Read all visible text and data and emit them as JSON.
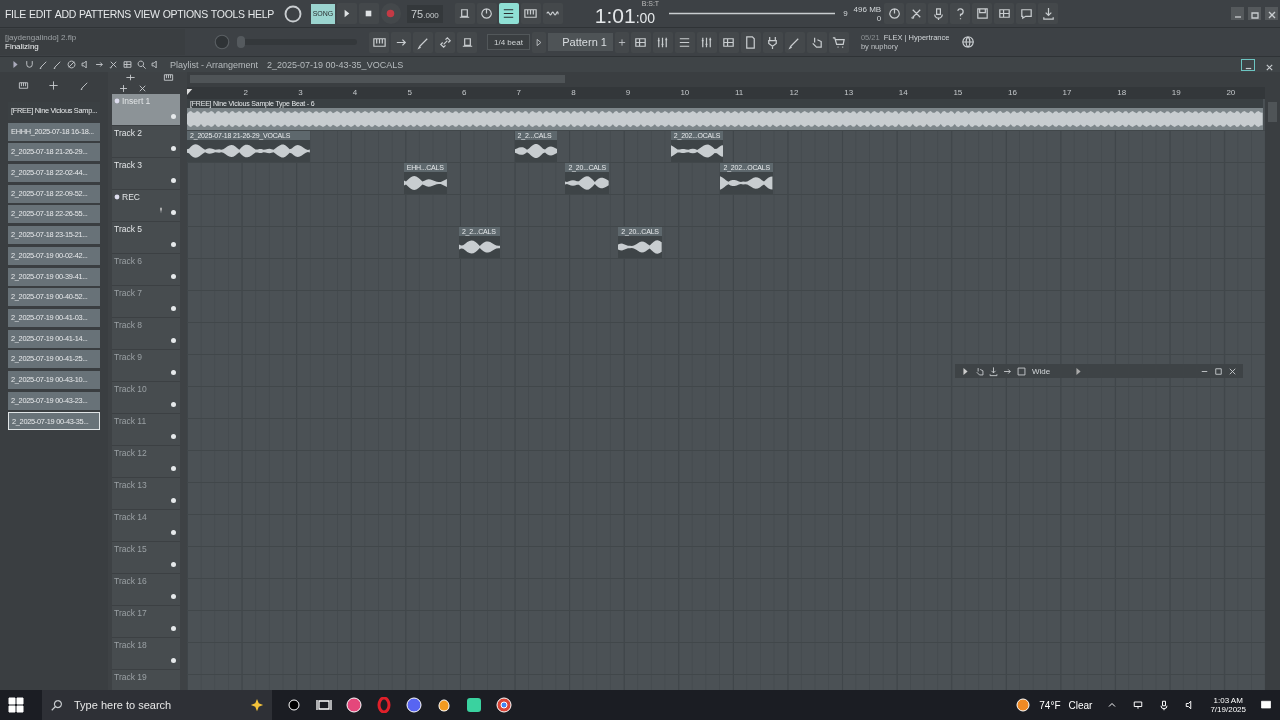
{
  "menu": [
    "FILE",
    "EDIT",
    "ADD",
    "PATTERNS",
    "VIEW",
    "OPTIONS",
    "TOOLS",
    "HELP"
  ],
  "transport": {
    "song_label": "SONG",
    "song_selected": true,
    "tempo": "75",
    "tempo_fraction": ".000",
    "recording": false
  },
  "toggles": [
    {
      "on": false
    },
    {
      "on": false
    },
    {
      "on": true
    },
    {
      "on": false
    },
    {
      "on": false
    }
  ],
  "time": {
    "value": "1:01",
    "sub": ":00",
    "unit": "B:S:T"
  },
  "meters": {
    "voices": "9",
    "memory": "496 MB",
    "cpu": "0"
  },
  "pitch": {
    "level": 0
  },
  "project": {
    "file": "[jaydengalindo] 2.flp",
    "status": "Finalizing"
  },
  "snap": "1/4 beat",
  "pattern": "Pattern 1",
  "news": {
    "counter": "05/21",
    "title": "FLEX | Hypertrance",
    "author": "by nuphory"
  },
  "playlist": {
    "title": "Playlist - Arrangement",
    "current": "2_2025-07-19 00-43-35_VOCALS"
  },
  "browser": [
    {
      "label": "[FREE] Nine Vicious Samp...",
      "selected": false,
      "kind": "beat"
    },
    {
      "label": "EHHH_2025-07-18 16-18...",
      "selected": false,
      "kind": "vocal"
    },
    {
      "label": "2_2025-07-18 21-26-29...",
      "selected": false,
      "kind": "vocal"
    },
    {
      "label": "2_2025-07-18 22-02-44...",
      "selected": false,
      "kind": "vocal"
    },
    {
      "label": "2_2025-07-18 22-09-52...",
      "selected": false,
      "kind": "vocal"
    },
    {
      "label": "2_2025-07-18 22-26-55...",
      "selected": false,
      "kind": "vocal"
    },
    {
      "label": "2_2025-07-18 23-15-21...",
      "selected": false,
      "kind": "vocal"
    },
    {
      "label": "2_2025-07-19 00-02-42...",
      "selected": false,
      "kind": "vocal"
    },
    {
      "label": "2_2025-07-19 00-39-41...",
      "selected": false,
      "kind": "vocal"
    },
    {
      "label": "2_2025-07-19 00-40-52...",
      "selected": false,
      "kind": "vocal"
    },
    {
      "label": "2_2025-07-19 00-41-03...",
      "selected": false,
      "kind": "vocal"
    },
    {
      "label": "2_2025-07-19 00-41-14...",
      "selected": false,
      "kind": "vocal"
    },
    {
      "label": "2_2025-07-19 00-41-25...",
      "selected": false,
      "kind": "vocal"
    },
    {
      "label": "2_2025-07-19 00-43-10...",
      "selected": false,
      "kind": "vocal"
    },
    {
      "label": "2_2025-07-19 00-43-23...",
      "selected": false,
      "kind": "vocal"
    },
    {
      "label": "2_2025-07-19 00-43-35...",
      "selected": true,
      "kind": "vocal"
    }
  ],
  "ruler": [
    "2",
    "3",
    "4",
    "5",
    "6",
    "7",
    "8",
    "9",
    "10",
    "11",
    "12",
    "13",
    "14",
    "15",
    "16",
    "17",
    "18",
    "19",
    "20"
  ],
  "tracks": [
    {
      "name": "Insert 1",
      "selected": true,
      "empty": false,
      "kind": "insert",
      "clips": [
        {
          "label": "[FREE] Nine Vicious Sample Type Beat - 6"
        }
      ]
    },
    {
      "name": "Track 2",
      "selected": false,
      "empty": false,
      "kind": "track",
      "clips": [
        {
          "label": "2_2025-07-18 21-26-29_VOCALS"
        },
        {
          "label": "2_2...CALS"
        },
        {
          "label": "2_202...OCALS"
        }
      ]
    },
    {
      "name": "Track 3",
      "selected": false,
      "empty": false,
      "kind": "track",
      "clips": [
        {
          "label": "EHH...CALS"
        },
        {
          "label": "2_20...CALS"
        },
        {
          "label": "2_202...OCALS"
        }
      ]
    },
    {
      "name": "REC",
      "selected": false,
      "empty": false,
      "kind": "record"
    },
    {
      "name": "Track 5",
      "selected": false,
      "empty": false,
      "kind": "track",
      "clips": [
        {
          "label": "2_2...CALS"
        },
        {
          "label": "2_20...CALS"
        }
      ]
    },
    {
      "name": "Track 6",
      "selected": false,
      "empty": true,
      "kind": "track"
    },
    {
      "name": "Track 7",
      "selected": false,
      "empty": true,
      "kind": "track"
    },
    {
      "name": "Track 8",
      "selected": false,
      "empty": true,
      "kind": "track"
    },
    {
      "name": "Track 9",
      "selected": false,
      "empty": true,
      "kind": "track"
    },
    {
      "name": "Track 10",
      "selected": false,
      "empty": true,
      "kind": "track"
    },
    {
      "name": "Track 11",
      "selected": false,
      "empty": true,
      "kind": "track"
    },
    {
      "name": "Track 12",
      "selected": false,
      "empty": true,
      "kind": "track"
    },
    {
      "name": "Track 13",
      "selected": false,
      "empty": true,
      "kind": "track"
    },
    {
      "name": "Track 14",
      "selected": false,
      "empty": true,
      "kind": "track"
    },
    {
      "name": "Track 15",
      "selected": false,
      "empty": true,
      "kind": "track"
    },
    {
      "name": "Track 16",
      "selected": false,
      "empty": true,
      "kind": "track"
    },
    {
      "name": "Track 17",
      "selected": false,
      "empty": true,
      "kind": "track"
    },
    {
      "name": "Track 18",
      "selected": false,
      "empty": true,
      "kind": "track"
    },
    {
      "name": "Track 19",
      "selected": false,
      "empty": true,
      "kind": "track"
    }
  ],
  "mini_window": {
    "label": "Wide"
  },
  "taskbar": {
    "search_placeholder": "Type here to search",
    "temperature": "74°F",
    "weather": "Clear",
    "time": "1:03 AM",
    "date": "7/19/2025"
  }
}
